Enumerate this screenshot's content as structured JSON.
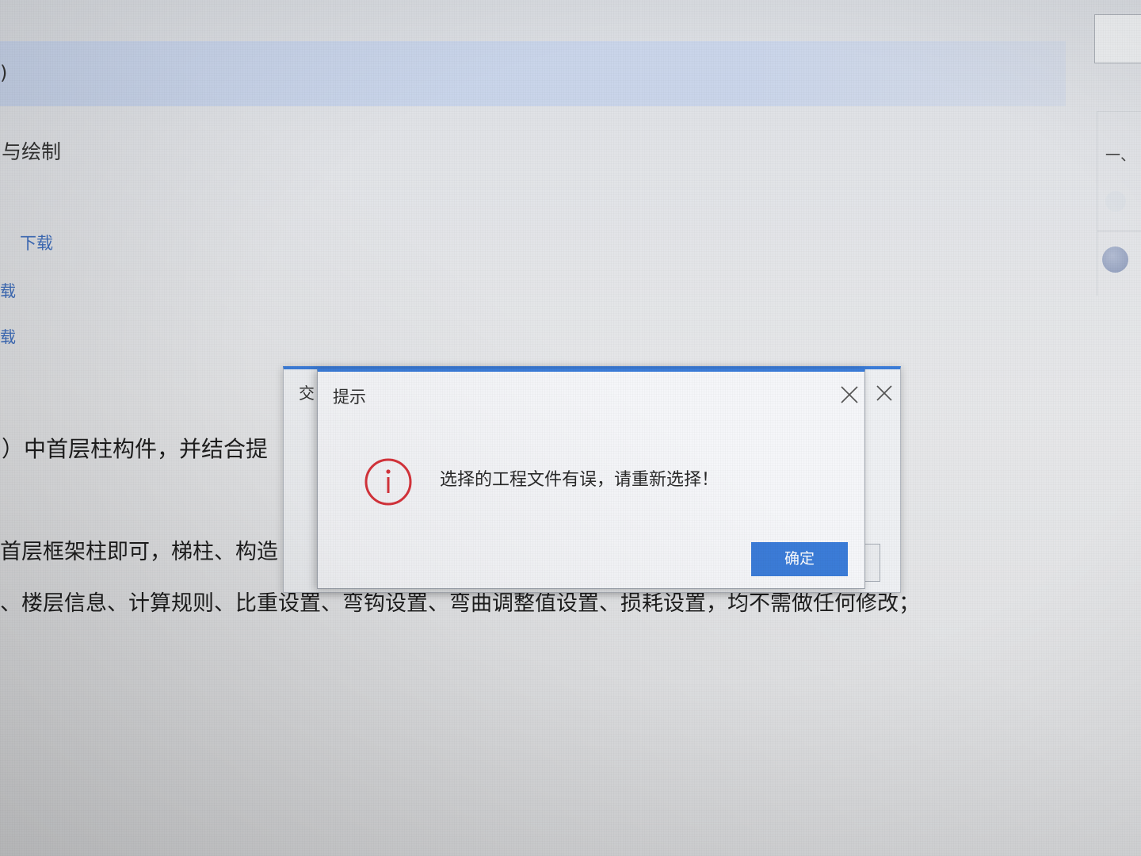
{
  "doc": {
    "banner_text": ")",
    "section_fragment": "与绘制",
    "links": [
      "下载",
      "载",
      "载"
    ],
    "paragraphs": [
      "）中首层柱构件，并结合提",
      "首层框架柱即可，梯柱、构造",
      "、楼层信息、计算规则、比重设置、弯钩设置、弯曲调整值设置、损耗设置，均不需做任何修改；"
    ]
  },
  "side_panel": {
    "heading_fragment": "一、",
    "avatar_icon": "avatar-icon"
  },
  "background_dialog": {
    "title_fragment": "交",
    "close_icon": "close-icon"
  },
  "alert_dialog": {
    "title": "提示",
    "icon": "info-icon",
    "message": "选择的工程文件有误，请重新选择！",
    "confirm_label": "确定",
    "close_icon": "close-icon"
  },
  "colors": {
    "accent": "#3b7cd8",
    "alert": "#d8343c",
    "link": "#3f6fbf",
    "banner": "#c8d4ea"
  }
}
